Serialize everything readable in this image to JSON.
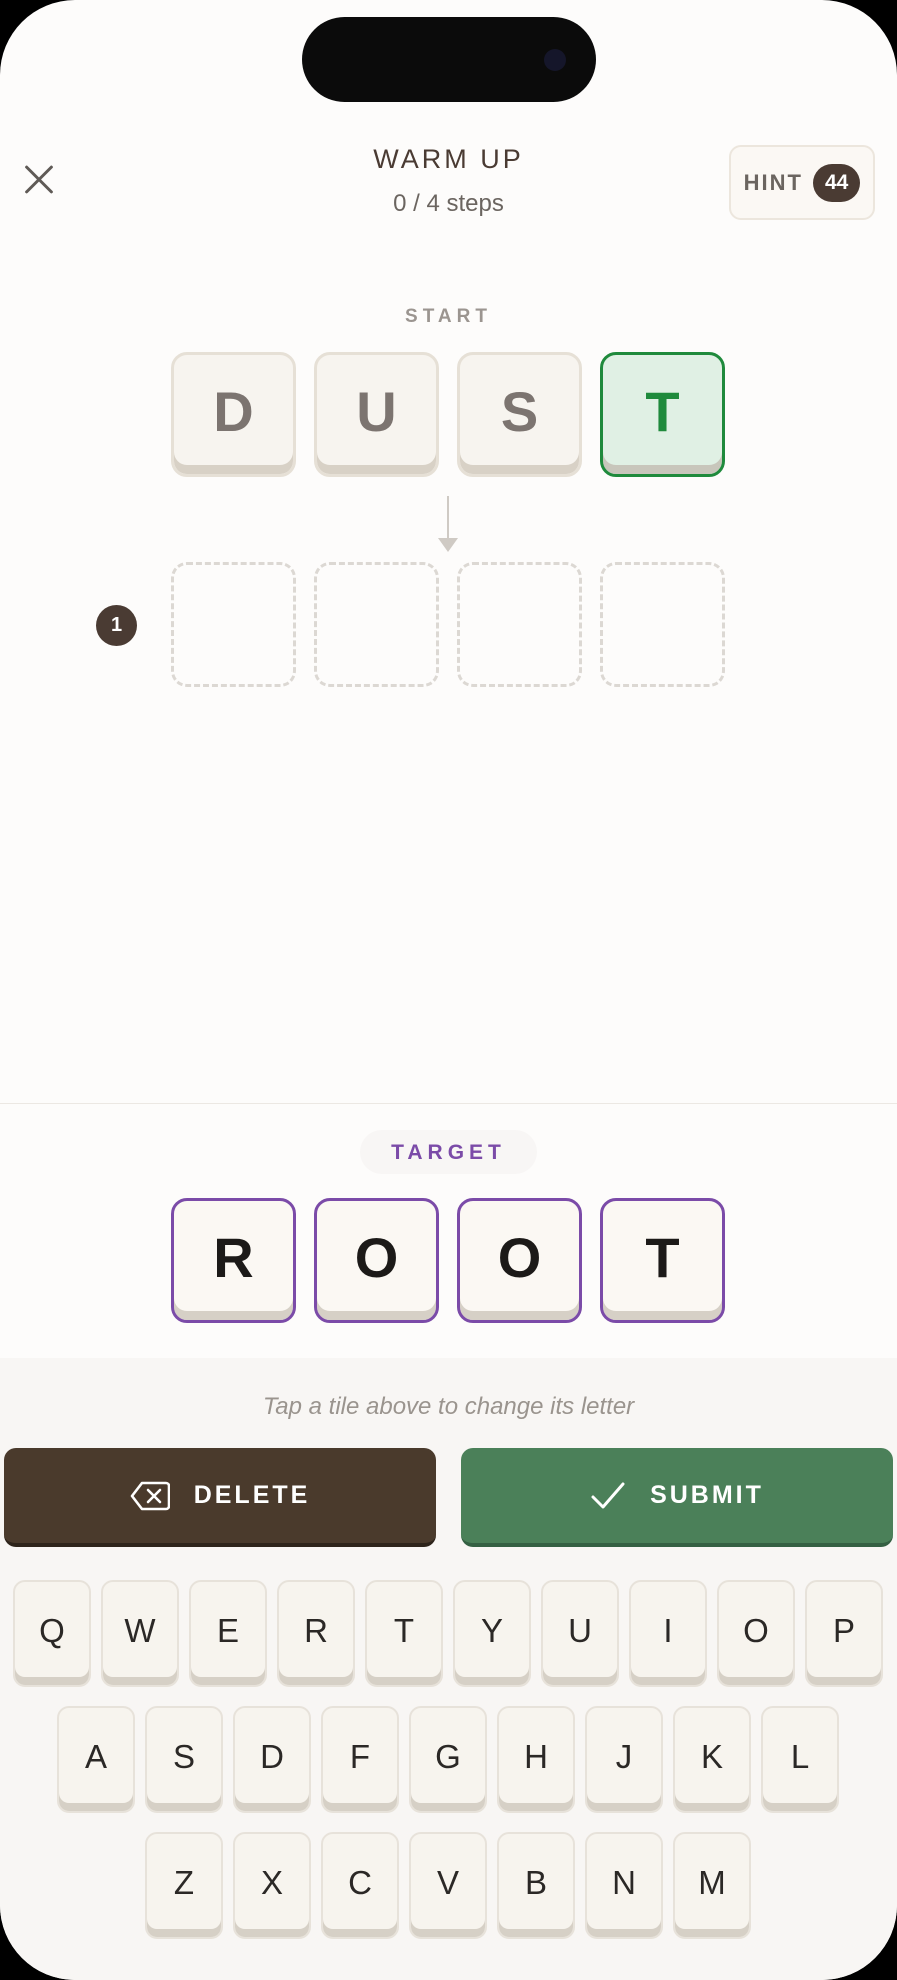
{
  "header": {
    "title": "WARM UP",
    "progress": "0 / 4 steps",
    "hint_label": "HINT",
    "hint_count": "44"
  },
  "start": {
    "label": "START",
    "letters": [
      "D",
      "U",
      "S",
      "T"
    ],
    "matching_index": 3
  },
  "step": {
    "number": "1",
    "letters": [
      "",
      "",
      "",
      ""
    ]
  },
  "target": {
    "label": "TARGET",
    "letters": [
      "R",
      "O",
      "O",
      "T"
    ]
  },
  "helper_text": "Tap a tile above to change its letter",
  "actions": {
    "delete_label": "DELETE",
    "submit_label": "SUBMIT"
  },
  "keyboard": {
    "row1": [
      "Q",
      "W",
      "E",
      "R",
      "T",
      "Y",
      "U",
      "I",
      "O",
      "P"
    ],
    "row2": [
      "A",
      "S",
      "D",
      "F",
      "G",
      "H",
      "J",
      "K",
      "L"
    ],
    "row3": [
      "Z",
      "X",
      "C",
      "V",
      "B",
      "N",
      "M"
    ]
  },
  "colors": {
    "brown": "#4a3a2c",
    "green": "#4b8059",
    "match_green": "#1f8a3c",
    "target_purple": "#7b4ba8"
  }
}
